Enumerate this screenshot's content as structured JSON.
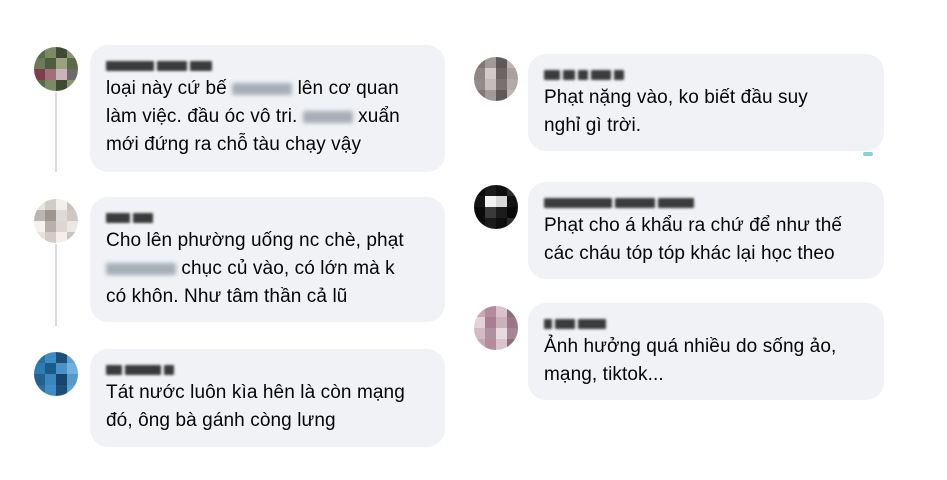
{
  "comments_left": [
    {
      "author": "",
      "text_parts": [
        "loại này cứ bế ",
        "",
        " lên cơ quan\nlàm việc. đầu óc vô tri. ",
        "",
        " xuẩn\nmới đứng ra chỗ tàu chạy vậy"
      ],
      "avatar_colors": [
        "#5a6b4a",
        "#7a8a62",
        "#3e4a33",
        "#8b9470",
        "#6d7a55",
        "#4f5d3f",
        "#9aa37e",
        "#5d6a48",
        "#7c3d4e",
        "#a0707a",
        "#c8b5b9",
        "#6f6a6a"
      ]
    },
    {
      "author": "",
      "text_parts": [
        "Cho lên phường uống nc chè, phạt\n",
        "",
        " chục củ vào, có lớn mà k\ncó khôn. Như tâm thần cả lũ"
      ],
      "avatar_colors": [
        "#e8e4e0",
        "#d2ccc8",
        "#f2efec",
        "#c9c2bd",
        "#bdb6b0",
        "#9e958f",
        "#e0dad6",
        "#cfc8c2",
        "#f5f2f0",
        "#b8b0aa",
        "#ddd6d1",
        "#ebe7e3"
      ]
    },
    {
      "author": "",
      "text_parts": [
        "Tát nước luôn kìa hên là còn mạng\nđó, ông bà gánh còng lưng"
      ],
      "avatar_colors": [
        "#2a6fa3",
        "#3f8cc4",
        "#1c4e78",
        "#5aa3d6",
        "#2d7bb0",
        "#1b5a8c",
        "#4a92c6",
        "#6fb0dd",
        "#245f8e",
        "#3b86bd",
        "#18456b",
        "#5899cc"
      ]
    }
  ],
  "comments_right": [
    {
      "author": "",
      "text_parts": [
        "Phạt nặng vào, ko biết đầu suy\nnghỉ gì trời."
      ],
      "avatar_colors": [
        "#7d7877",
        "#a09998",
        "#5e5958",
        "#bcb4b2",
        "#8e8786",
        "#d2cac8",
        "#6b6564",
        "#a9a1a0",
        "#908a89",
        "#c5bdbb",
        "#777170",
        "#b2aaa8"
      ]
    },
    {
      "author": "",
      "text_parts": [
        "Phạt cho á khẩu ra chứ để như thế\ncác cháu tóp tóp khác lại học theo"
      ],
      "avatar_colors": [
        "#0b0b0b",
        "#1a1a1a",
        "#0e0e0e",
        "#2b2b2b",
        "#151515",
        "#f2f2f2",
        "#d8d8d8",
        "#111111",
        "#0a0a0a",
        "#3a3a3a",
        "#1c1c1c",
        "#080808"
      ]
    },
    {
      "author": "",
      "text_parts": [
        "Ảnh hưởng quá nhiều do sống ảo,\nmạng, tiktok..."
      ],
      "avatar_colors": [
        "#c9a7b4",
        "#b58a9c",
        "#d9c3cc",
        "#8f6d7b",
        "#e3d3d9",
        "#a77f91",
        "#cbb1bc",
        "#9c7687",
        "#d2b9c3",
        "#b0909e",
        "#e8dbe0",
        "#a58495"
      ]
    }
  ]
}
